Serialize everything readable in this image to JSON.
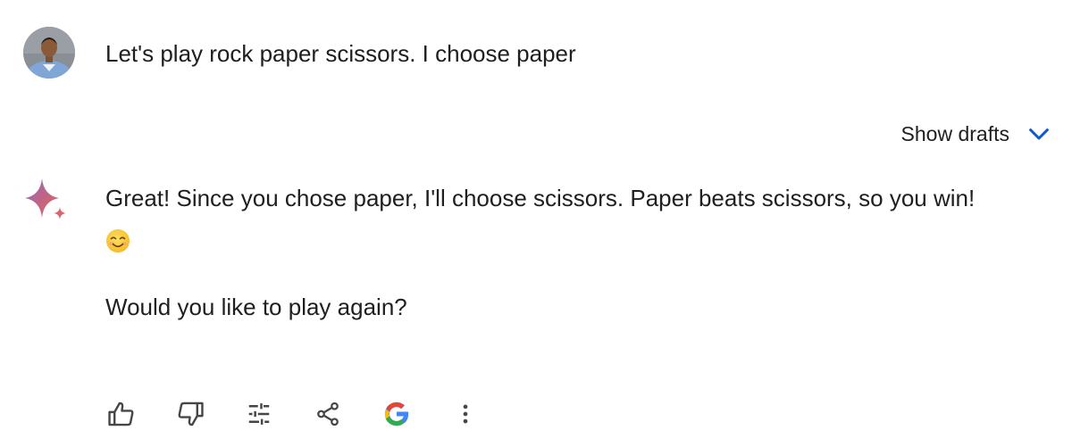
{
  "user": {
    "message": "Let's play rock paper scissors. I choose paper"
  },
  "drafts": {
    "label": "Show drafts"
  },
  "response": {
    "line1": "Great!  Since you chose paper, I'll choose scissors. Paper beats scissors, so you win!",
    "line2": "Would you like to play again?"
  },
  "actions": [
    {
      "icon": "thumb-up-icon"
    },
    {
      "icon": "thumb-down-icon"
    },
    {
      "icon": "tune-icon"
    },
    {
      "icon": "share-icon"
    },
    {
      "icon": "google-icon"
    },
    {
      "icon": "more-vert-icon"
    }
  ],
  "colors": {
    "accent": "#0b57d0",
    "text": "#1f1f1f",
    "icon": "#444746",
    "spark_start": "#9168c0",
    "spark_end": "#d96570"
  }
}
